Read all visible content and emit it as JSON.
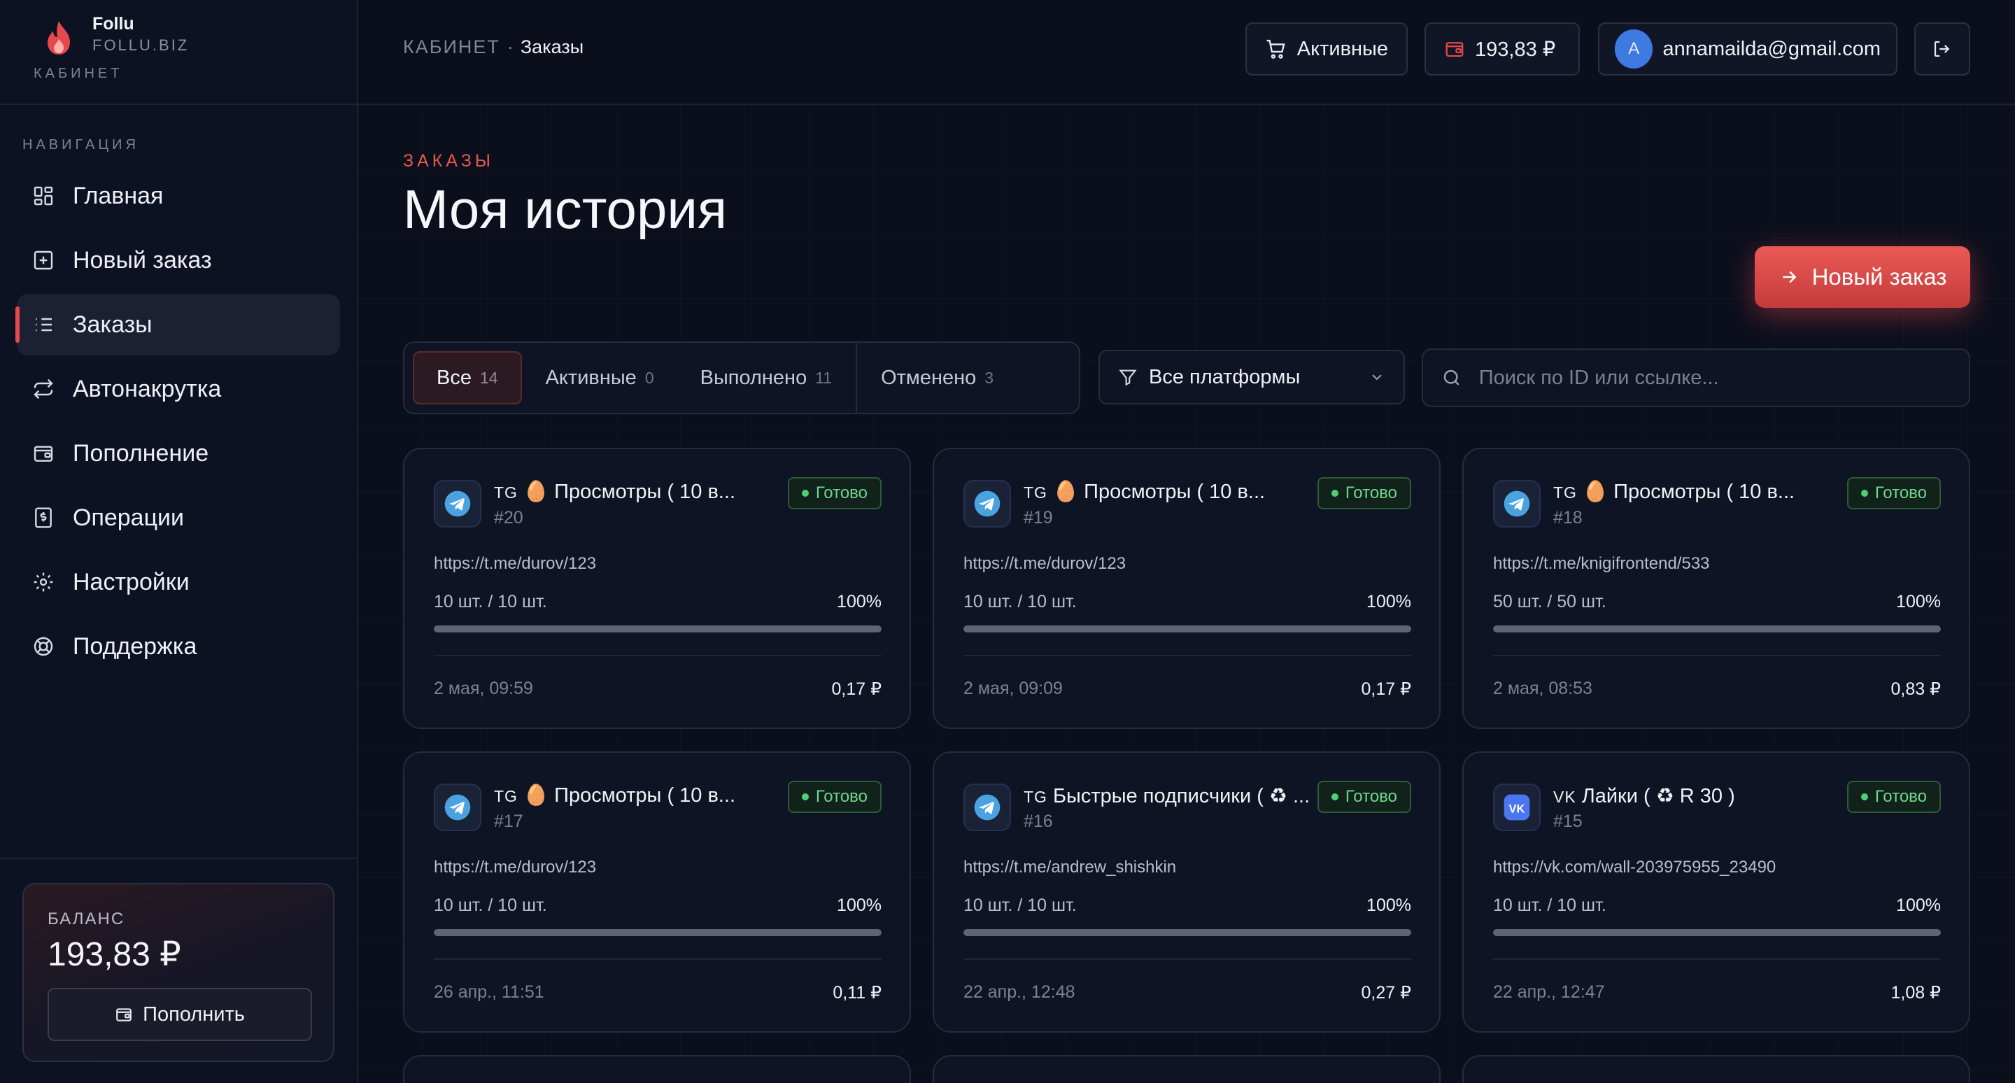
{
  "brand": {
    "name": "Follu",
    "domain": "FOLLU.BIZ",
    "section": "КАБИНЕТ"
  },
  "nav": {
    "label": "НАВИГАЦИЯ",
    "items": [
      {
        "label": "Главная",
        "icon": "dashboard-icon"
      },
      {
        "label": "Новый заказ",
        "icon": "plus-square-icon"
      },
      {
        "label": "Заказы",
        "icon": "list-icon",
        "active": true
      },
      {
        "label": "Автонакрутка",
        "icon": "repeat-icon"
      },
      {
        "label": "Пополнение",
        "icon": "wallet-icon"
      },
      {
        "label": "Операции",
        "icon": "receipt-icon"
      },
      {
        "label": "Настройки",
        "icon": "gear-icon"
      },
      {
        "label": "Поддержка",
        "icon": "lifebuoy-icon"
      }
    ]
  },
  "sidebar_balance": {
    "label": "БАЛАНС",
    "value": "193,83 ₽",
    "topup_label": "Пополнить"
  },
  "topbar": {
    "breadcrumb_root": "КАБИНЕТ",
    "breadcrumb_sep": "·",
    "breadcrumb_current": "Заказы",
    "active_label": "Активные",
    "balance": "193,83 ₽",
    "avatar_letter": "A",
    "email": "annamailda@gmail.com"
  },
  "header": {
    "section_label": "ЗАКАЗЫ",
    "title": "Моя история",
    "new_order_label": "Новый заказ"
  },
  "filters": {
    "tabs": [
      {
        "label": "Все",
        "count": "14",
        "active": true
      },
      {
        "label": "Активные",
        "count": "0"
      },
      {
        "label": "Выполнено",
        "count": "11"
      },
      {
        "label": "Отменено",
        "count": "3"
      }
    ],
    "platform_select": "Все платформы",
    "search_placeholder": "Поиск по ID или ссылке..."
  },
  "colors": {
    "accent": "#e5484d",
    "success": "#4ecf77",
    "telegram": "#4aa3e0",
    "vk": "#4c75f2"
  },
  "orders": [
    {
      "platform": "TG",
      "title": "🥚 Просмотры ( 10 в...",
      "id": "#20",
      "status": "Готово",
      "link": "https://t.me/durov/123",
      "qty": "10 шт. / 10 шт.",
      "percent": "100%",
      "progress": 1.0,
      "date": "2 мая, 09:59",
      "price": "0,17 ₽"
    },
    {
      "platform": "TG",
      "title": "🥚 Просмотры ( 10 в...",
      "id": "#19",
      "status": "Готово",
      "link": "https://t.me/durov/123",
      "qty": "10 шт. / 10 шт.",
      "percent": "100%",
      "progress": 1.0,
      "date": "2 мая, 09:09",
      "price": "0,17 ₽"
    },
    {
      "platform": "TG",
      "title": "🥚 Просмотры ( 10 в...",
      "id": "#18",
      "status": "Готово",
      "link": "https://t.me/knigifrontend/533",
      "qty": "50 шт. / 50 шт.",
      "percent": "100%",
      "progress": 1.0,
      "date": "2 мая, 08:53",
      "price": "0,83 ₽"
    },
    {
      "platform": "TG",
      "title": "🥚 Просмотры ( 10 в...",
      "id": "#17",
      "status": "Готово",
      "link": "https://t.me/durov/123",
      "qty": "10 шт. / 10 шт.",
      "percent": "100%",
      "progress": 1.0,
      "date": "26 апр., 11:51",
      "price": "0,11 ₽"
    },
    {
      "platform": "TG",
      "title": "Быстрые подписчики ( ♻ ...",
      "id": "#16",
      "status": "Готово",
      "link": "https://t.me/andrew_shishkin",
      "qty": "10 шт. / 10 шт.",
      "percent": "100%",
      "progress": 1.0,
      "date": "22 апр., 12:48",
      "price": "0,27 ₽"
    },
    {
      "platform": "VK",
      "title": "Лайки ( ♻ R 30 )",
      "id": "#15",
      "status": "Готово",
      "link": "https://vk.com/wall-203975955_23490",
      "qty": "10 шт. / 10 шт.",
      "percent": "100%",
      "progress": 1.0,
      "date": "22 апр., 12:47",
      "price": "1,08 ₽"
    }
  ]
}
